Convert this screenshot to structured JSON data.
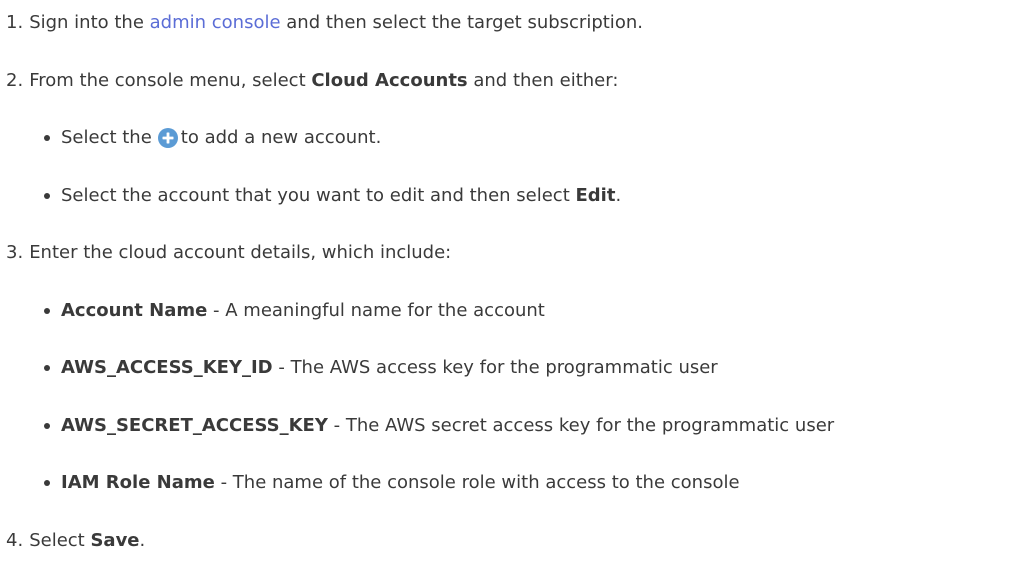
{
  "steps": [
    {
      "number": "1.",
      "pre": "Sign into the ",
      "link": "admin console",
      "post": " and then select the target subscription."
    },
    {
      "number": "2.",
      "pre": "From the console menu, select ",
      "bold": "Cloud Accounts",
      "post": " and then either:",
      "subitems": [
        {
          "pre": "Select the",
          "icon": "plus-circle-icon",
          "post": "to add a new account."
        },
        {
          "pre": "Select the account that you want to edit and then select ",
          "bold": "Edit",
          "post": "."
        }
      ]
    },
    {
      "number": "3.",
      "text": "Enter the cloud account details, which include:",
      "subitems": [
        {
          "bold": "Account Name",
          "post": " - A meaningful name for the account"
        },
        {
          "bold": "AWS_ACCESS_KEY_ID",
          "post": " - The AWS access key for the programmatic user"
        },
        {
          "bold": "AWS_SECRET_ACCESS_KEY",
          "post": " - The AWS secret access key for the programmatic user"
        },
        {
          "bold": "IAM Role Name",
          "post": " - The name of the console role with access to the console"
        }
      ]
    },
    {
      "number": "4.",
      "pre": "Select ",
      "bold": "Save",
      "post": "."
    }
  ],
  "colors": {
    "text": "#3a3a3a",
    "link": "#5b6dd6",
    "icon": "#5b9bd5"
  }
}
